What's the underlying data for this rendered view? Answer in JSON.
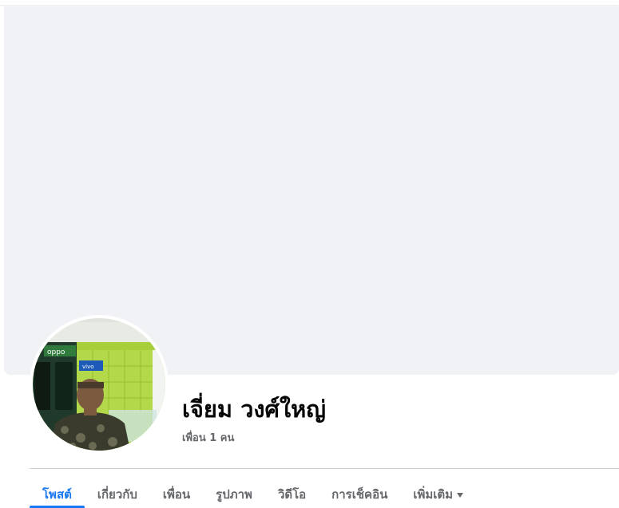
{
  "profile": {
    "name": "เจี่ยม วงศ์ใหญ่",
    "friends_count_text": "เพื่อน 1 คน"
  },
  "tabs": [
    {
      "label": "โพสต์",
      "active": true
    },
    {
      "label": "เกี่ยวกับ",
      "active": false
    },
    {
      "label": "เพื่อน",
      "active": false
    },
    {
      "label": "รูปภาพ",
      "active": false
    },
    {
      "label": "วิดีโอ",
      "active": false
    },
    {
      "label": "การเช็คอิน",
      "active": false
    },
    {
      "label": "เพิ่มเติม",
      "active": false,
      "icon": "caret-down-icon"
    }
  ],
  "avatar_photo": {
    "store_sign": "oppo",
    "store_sign_2": "vivo"
  },
  "colors": {
    "accent": "#1877f2",
    "cover_bg": "#f0f2f5",
    "text_primary": "#050505",
    "text_secondary": "#65676b"
  }
}
